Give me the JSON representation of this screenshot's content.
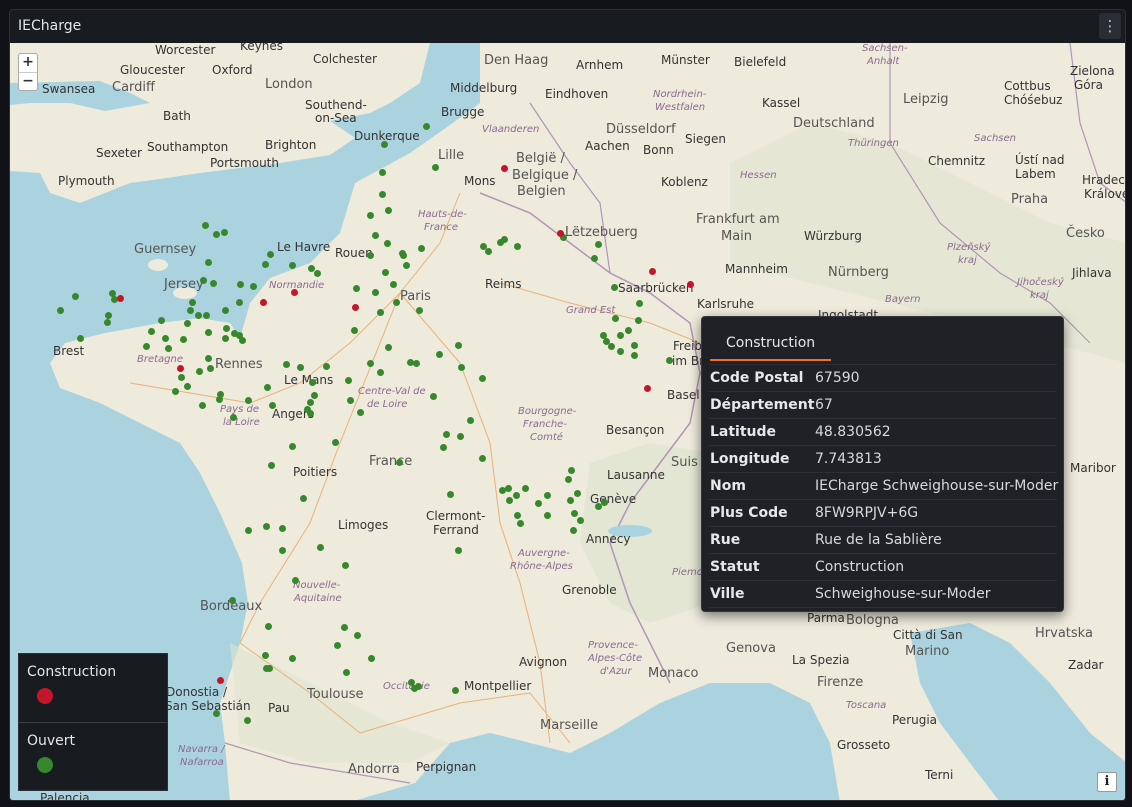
{
  "panel": {
    "title": "IECharge",
    "menu_icon": "ellipsis-vertical-icon"
  },
  "map": {
    "zoom_in": "+",
    "zoom_out": "−",
    "info": "i",
    "labels": {
      "worcester": "Worcester",
      "colchester": "Colchester",
      "keynes": "Keynes",
      "gloucester": "Gloucester",
      "oxford": "Oxford",
      "swansea": "Swansea",
      "cardiff": "Cardiff",
      "london": "London",
      "southend": "Southend-",
      "onsea": "on-Sea",
      "bath": "Bath",
      "exeter": "Sexeter",
      "southampton": "Southampton",
      "brighton": "Brighton",
      "portsmouth": "Portsmouth",
      "plymouth": "Plymouth",
      "dunkerque": "Dunkerque",
      "denhaag": "Den Haag",
      "middelburg": "Middelburg",
      "brugge": "Brugge",
      "arnhem": "Arnhem",
      "eindhoven": "Eindhoven",
      "munster": "Münster",
      "bielefeld": "Bielefeld",
      "kassel": "Kassel",
      "leipzig": "Leipzig",
      "dusseldorf": "Düsseldorf",
      "aachen": "Aachen",
      "bonn": "Bonn",
      "siegen": "Siegen",
      "deutschland": "Deutschland",
      "lille": "Lille",
      "mons": "Mons",
      "belgie1": "België /",
      "belgie2": "Belgique /",
      "belgie3": "Belgien",
      "koblenz": "Koblenz",
      "frankfurt": "Frankfurt am",
      "main": "Main",
      "chemnitz": "Chemnitz",
      "usti": "Ústí nad",
      "labem": "Labem",
      "praha": "Praha",
      "cesko": "Česko",
      "wurzburg": "Würzburg",
      "nurnberg": "Nürnberg",
      "mannheim": "Mannheim",
      "letzebuerg": "Lëtzebuerg",
      "saarbrucken": "Saarbrücken",
      "karlsruhe": "Karlsruhe",
      "ingolstadt": "Ingolstadt",
      "reims": "Reims",
      "grandest": "Grand Est",
      "paris": "Paris",
      "rouen": "Rouen",
      "lehavre": "Le Havre",
      "guernsey": "Guernsey",
      "jersey": "Jersey",
      "normandie": "Normandie",
      "brest": "Brest",
      "rennes": "Rennes",
      "bretagne": "Bretagne",
      "lemans": "Le Mans",
      "angers": "Angers",
      "paysdelaloire1": "Pays de",
      "paysdelaloire2": "la Loire",
      "centre1": "Centre-Val de",
      "centre2": "de Loire",
      "france": "France",
      "poitiers": "Poitiers",
      "limoges": "Limoges",
      "bourgogne1": "Bourgogne-",
      "bourgogne2": "Franche-",
      "bourgogne3": "Comté",
      "besancon": "Besançon",
      "basel": "Basel",
      "lausanne": "Lausanne",
      "geneve": "Genève",
      "clermont1": "Clermont-",
      "clermont2": "Ferrand",
      "annecy": "Annecy",
      "auvergne1": "Auvergne-",
      "auvergne2": "Rhône-Alpes",
      "grenoble": "Grenoble",
      "bordeaux": "Bordeaux",
      "nouvelle1": "Nouvelle-",
      "nouvelle2": "Aquitaine",
      "toulouse": "Toulouse",
      "occitanie": "Occitanie",
      "donostia1": "Donostia /",
      "donostia2": "San Sebastián",
      "pau": "Pau",
      "navarra1": "Navarra /",
      "navarra2": "Nafarroa",
      "andorra": "Andorra",
      "perpignan": "Perpignan",
      "montpellier": "Montpellier",
      "avignon": "Avignon",
      "marseille": "Marseille",
      "provence1": "Provence-",
      "provence2": "Alpes-Côte",
      "provence3": "d'Azur",
      "monaco": "Monaco",
      "genova": "Genova",
      "laspezia": "La Spezia",
      "bologna": "Bologna",
      "parma": "Parma",
      "firenze": "Firenze",
      "toscana": "Toscana",
      "perugia": "Perugia",
      "grosseto": "Grosseto",
      "citta1": "Città di San",
      "citta2": "Marino",
      "hrvatska": "Hrvatska",
      "zadar": "Zadar",
      "maribor": "Maribor",
      "terni": "Terni",
      "palencia": "Palencia",
      "piemonte": "Piemo",
      "suisse": "Suis",
      "freiburg": "Freib",
      "imbreis": "im Bre",
      "sachsen": "Sachsen",
      "thuringen": "Thüringen",
      "hessen": "Hessen",
      "bayern": "Bayern",
      "nordrhein1": "Nordrhein-",
      "nordrhein2": "Westfalen",
      "vlaanderen": "Vlaanderen",
      "hautsdefrance1": "Hauts-de-",
      "hautsdefrance2": "France",
      "cottbus1": "Cottbus",
      "cottbus2": "Chóśebuz",
      "zielona1": "Zielona",
      "zielona2": "Góra",
      "hradec1": "Hradec",
      "hradec2": "Králové",
      "jihlava": "Jihlava",
      "plzensky1": "Plzeňský",
      "plzensky2": "kraj",
      "jihocesky1": "Jihočeský",
      "jihocesky2": "kraj",
      "sachsenanhalt1": "Sachsen-",
      "sachsenanhalt2": "Anhalt"
    },
    "colors": {
      "construction": "#c4162a",
      "ouvert": "#37872d"
    }
  },
  "legend": {
    "items": [
      {
        "label": "Construction",
        "color": "#c4162a"
      },
      {
        "label": "Ouvert",
        "color": "#37872d"
      }
    ]
  },
  "tooltip": {
    "tab": "Construction",
    "rows": [
      {
        "key": "Code Postal",
        "value": "67590"
      },
      {
        "key": "Département",
        "value": "67"
      },
      {
        "key": "Latitude",
        "value": "48.830562"
      },
      {
        "key": "Longitude",
        "value": "7.743813"
      },
      {
        "key": "Nom",
        "value": "IECharge Schweighouse-sur-Moder"
      },
      {
        "key": "Plus Code",
        "value": "8FW9RPJV+6G"
      },
      {
        "key": "Rue",
        "value": "Rue de la Sablière"
      },
      {
        "key": "Statut",
        "value": "Construction"
      },
      {
        "key": "Ville",
        "value": "Schweighouse-sur-Moder"
      }
    ]
  }
}
